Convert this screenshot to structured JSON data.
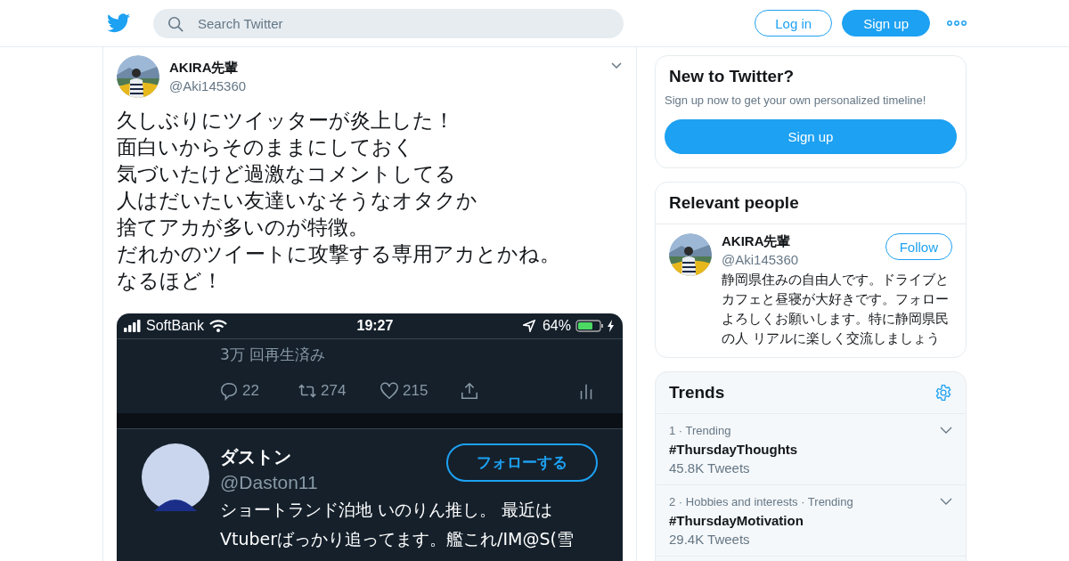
{
  "header": {
    "search": {
      "placeholder": "Search Twitter"
    },
    "login": "Log in",
    "signup": "Sign up"
  },
  "tweet": {
    "name": "AKIRA先輩",
    "handle": "@Aki145360",
    "text_lines": [
      "久しぶりにツイッターが炎上した！",
      "面白いからそのままにしておく",
      "気づいたけど過激なコメントしてる",
      "人はだいたい友達いなそうなオタクか",
      "捨てアカが多いのが特徴。",
      "だれかのツイートに攻撃する専用アカとかね。",
      "なるほど！"
    ],
    "screenshot": {
      "carrier": "SoftBank",
      "time": "19:27",
      "battery": "64%",
      "views": "3万 回再生済み",
      "actions": [
        {
          "kind": "reply",
          "count": "22"
        },
        {
          "kind": "retweet",
          "count": "274"
        },
        {
          "kind": "like",
          "count": "215"
        },
        {
          "kind": "share"
        },
        {
          "kind": "stats"
        }
      ],
      "profile": {
        "name": "ダストン",
        "handle": "@Daston11",
        "follow": "フォローする",
        "bio_lines": [
          "ショートランド泊地 いのりん推し。 最近は",
          "Vtuberばっかり追ってます。艦これ/IM@S(雪"
        ]
      }
    }
  },
  "sidebar": {
    "new_to_twitter": {
      "title": "New to Twitter?",
      "text": "Sign up now to get your own personalized timeline!",
      "button": "Sign up"
    },
    "relevant": {
      "title": "Relevant people",
      "people": [
        {
          "name": "AKIRA先輩",
          "handle": "@Aki145360",
          "follow": "Follow",
          "bio": "静岡県住みの自由人です。ドライブとカフェと昼寝が大好きです。フォローよろしくお願いします。特に静岡県民の人 リアルに楽しく交流しましょう"
        }
      ]
    },
    "trends": {
      "title": "Trends",
      "items": [
        {
          "meta": "1 · Trending",
          "tag": "#ThursdayThoughts",
          "count": "45.8K Tweets"
        },
        {
          "meta": "2 · Hobbies and interests · Trending",
          "tag": "#ThursdayMotivation",
          "count": "29.4K Tweets"
        }
      ]
    }
  }
}
